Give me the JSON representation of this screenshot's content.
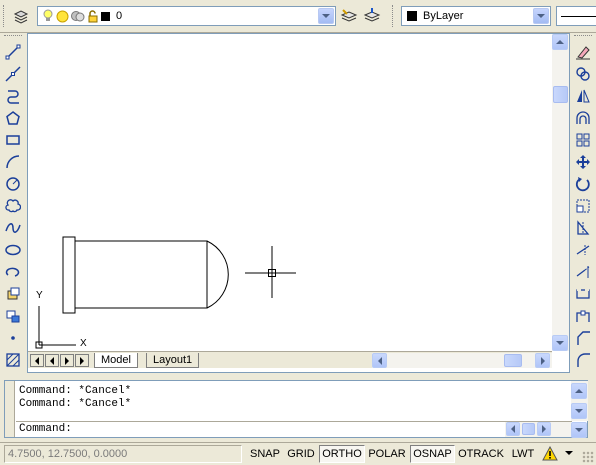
{
  "layer_toolbar": {
    "current_layer": "0"
  },
  "properties_toolbar": {
    "color_value": "ByLayer",
    "linetype_value": ""
  },
  "draw_tools": [
    "line",
    "construction-line",
    "polyline",
    "polygon",
    "rectangle",
    "arc",
    "circle",
    "revision-cloud",
    "spline",
    "ellipse",
    "ellipse-arc",
    "insert-block",
    "make-block",
    "point",
    "hatch"
  ],
  "modify_tools": [
    "erase",
    "copy",
    "mirror",
    "offset",
    "array",
    "move",
    "rotate",
    "scale",
    "stretch",
    "trim",
    "extend",
    "break",
    "join",
    "chamfer",
    "fillet"
  ],
  "ucs": {
    "x_label": "X",
    "y_label": "Y"
  },
  "layout_tabs": [
    {
      "label": "Model",
      "active": true
    },
    {
      "label": "Layout1",
      "active": false
    }
  ],
  "command": {
    "history": [
      "Command: *Cancel*",
      "Command: *Cancel*"
    ],
    "prompt": "Command:"
  },
  "status": {
    "coordinates": "4.7500, 12.7500, 0.0000",
    "toggles": [
      {
        "label": "SNAP",
        "on": false
      },
      {
        "label": "GRID",
        "on": false
      },
      {
        "label": "ORTHO",
        "on": true
      },
      {
        "label": "POLAR",
        "on": false
      },
      {
        "label": "OSNAP",
        "on": true
      },
      {
        "label": "OTRACK",
        "on": false
      },
      {
        "label": "LWT",
        "on": false
      }
    ]
  }
}
